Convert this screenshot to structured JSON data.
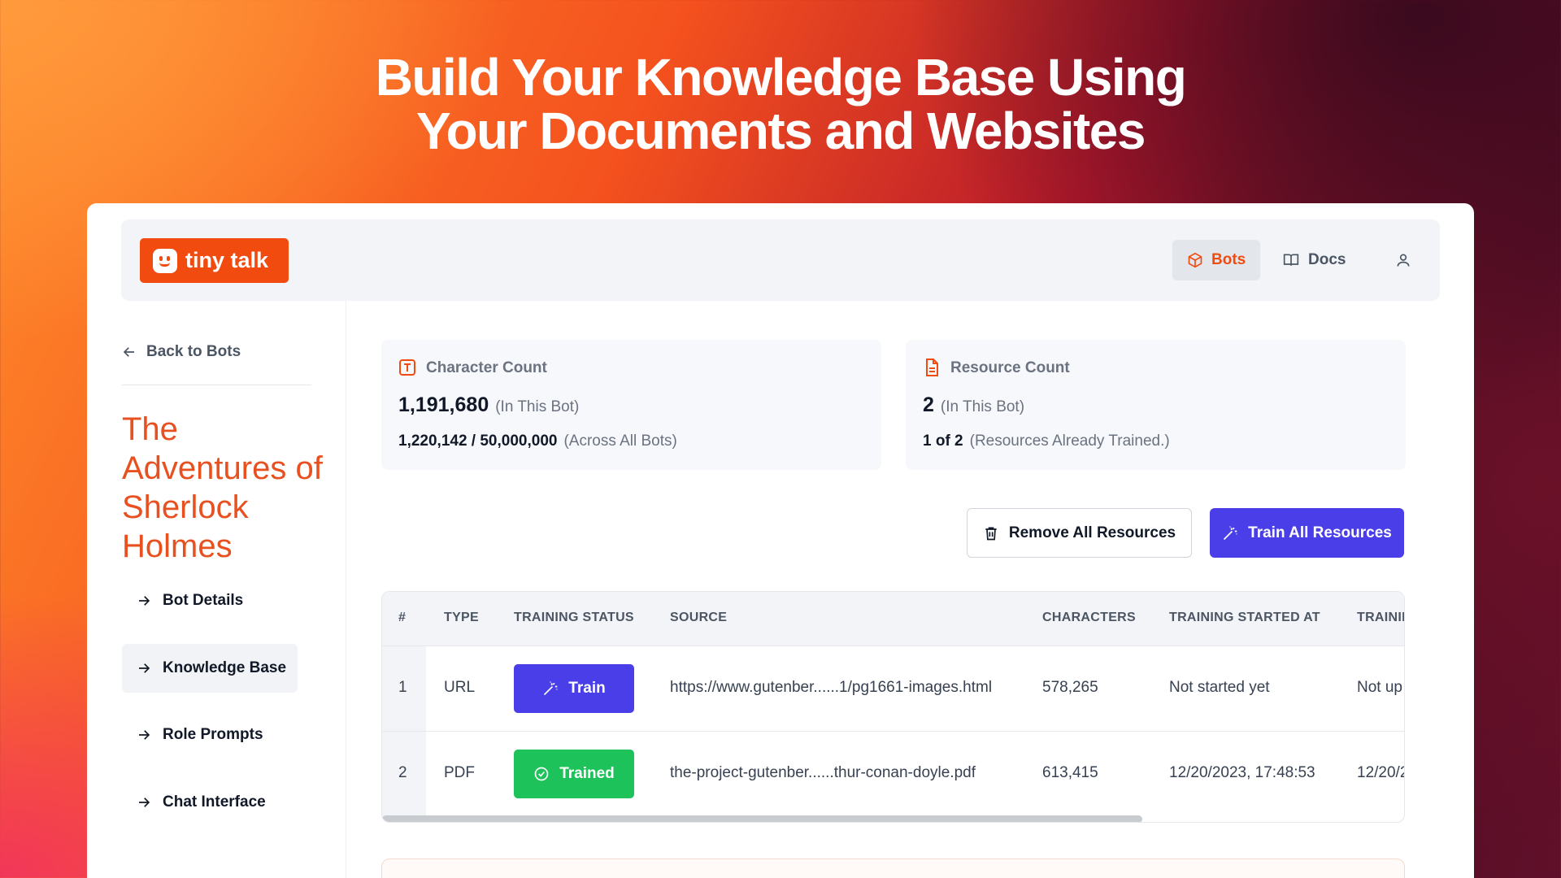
{
  "headline": {
    "line1": "Build Your Knowledge Base Using",
    "line2": "Your Documents and Websites"
  },
  "brand": {
    "name": "tiny talk",
    "color": "#f24b10"
  },
  "nav": {
    "bots": "Bots",
    "docs": "Docs"
  },
  "sidebar": {
    "back": "Back to Bots",
    "bot_title": "The Adventures of Sherlock Holmes",
    "items": [
      {
        "label": "Bot Details",
        "active": false
      },
      {
        "label": "Knowledge Base",
        "active": true
      },
      {
        "label": "Role Prompts",
        "active": false
      },
      {
        "label": "Chat Interface",
        "active": false
      }
    ]
  },
  "stats": {
    "characters": {
      "label": "Character Count",
      "value": "1,191,680",
      "value_note": "(In This Bot)",
      "total": "1,220,142 / 50,000,000",
      "total_note": "(Across All Bots)"
    },
    "resources": {
      "label": "Resource Count",
      "value": "2",
      "value_note": "(In This Bot)",
      "trained": "1 of 2",
      "trained_note": "(Resources Already Trained.)"
    }
  },
  "actions": {
    "remove_all": "Remove All Resources",
    "train_all": "Train All Resources"
  },
  "table": {
    "headers": [
      "#",
      "TYPE",
      "TRAINING STATUS",
      "SOURCE",
      "CHARACTERS",
      "TRAINING STARTED AT",
      "TRAININ"
    ],
    "rows": [
      {
        "index": "1",
        "type": "URL",
        "status": "Train",
        "source": "https://www.gutenber......1/pg1661-images.html",
        "characters": "578,265",
        "started": "Not started yet",
        "updated": "Not up"
      },
      {
        "index": "2",
        "type": "PDF",
        "status": "Trained",
        "source": "the-project-gutenber......thur-conan-doyle.pdf",
        "characters": "613,415",
        "started": "12/20/2023, 17:48:53",
        "updated": "12/20/2"
      }
    ]
  },
  "colors": {
    "accent": "#4a3ee8",
    "success": "#1ec25a",
    "title": "#e8501f"
  }
}
